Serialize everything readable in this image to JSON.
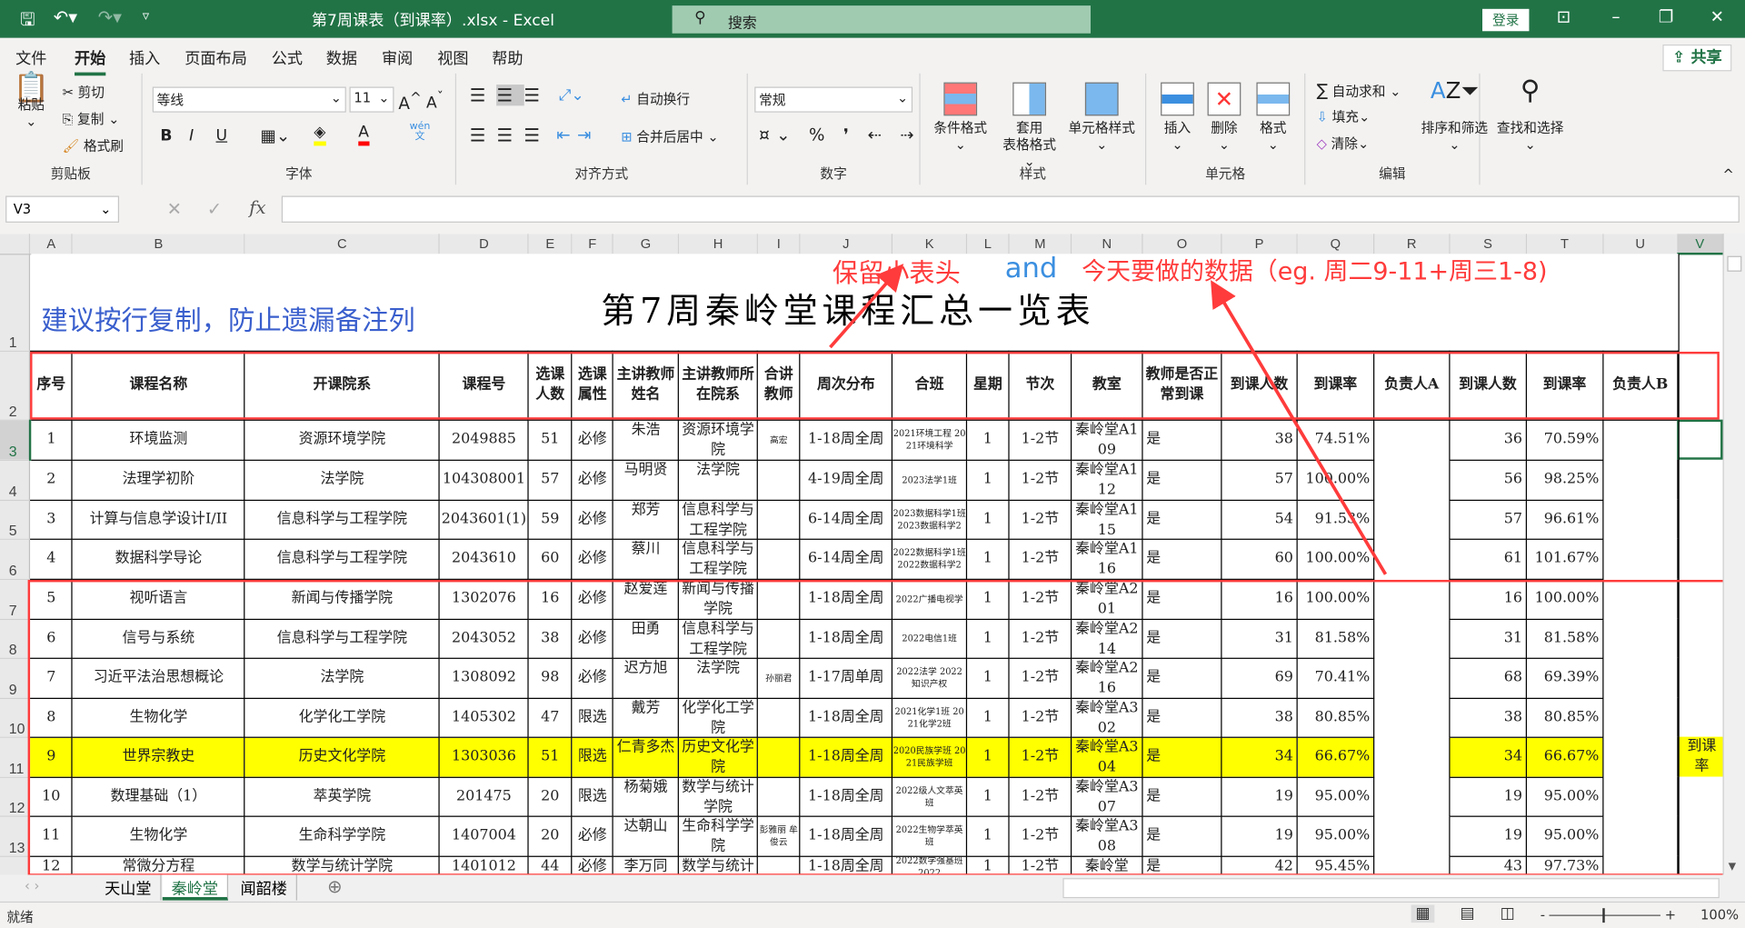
{
  "window": {
    "title": "第7周课表（到课率）.xlsx  -  Excel",
    "search_placeholder": "搜索",
    "login": "登录"
  },
  "menu": [
    "文件",
    "开始",
    "插入",
    "页面布局",
    "公式",
    "数据",
    "审阅",
    "视图",
    "帮助"
  ],
  "share": "共享",
  "ribbon": {
    "clipboard": {
      "label": "剪贴板",
      "paste": "粘贴",
      "cut": "剪切",
      "copy": "复制",
      "format_painter": "格式刷"
    },
    "font": {
      "label": "字体",
      "font_name": "等线",
      "font_size": "11",
      "bold": "B",
      "italic": "I",
      "underline": "U",
      "fill_color": "#ffff00",
      "font_color": "#ff0000"
    },
    "alignment": {
      "label": "对齐方式",
      "wrap": "自动换行",
      "merge": "合并后居中"
    },
    "number": {
      "label": "数字",
      "format": "常规"
    },
    "styles": {
      "label": "样式",
      "conditional": "条件格式",
      "table_l1": "套用",
      "table_l2": "表格格式",
      "cell_styles": "单元格样式"
    },
    "cells": {
      "label": "单元格",
      "insert": "插入",
      "delete": "删除",
      "format": "格式"
    },
    "editing": {
      "label": "编辑",
      "autosum": "自动求和",
      "fill": "填充",
      "clear": "清除",
      "sort_filter": "排序和筛选",
      "find_select": "查找和选择"
    }
  },
  "formula_bar": {
    "name_box": "V3",
    "formula": ""
  },
  "columns": [
    "A",
    "B",
    "C",
    "D",
    "E",
    "F",
    "G",
    "H",
    "I",
    "J",
    "K",
    "L",
    "M",
    "N",
    "O",
    "P",
    "Q",
    "R",
    "S",
    "T",
    "U",
    "V"
  ],
  "row_numbers": [
    "1",
    "2",
    "3",
    "4",
    "5",
    "6",
    "7",
    "8",
    "9",
    "10",
    "11",
    "12",
    "13"
  ],
  "sheet": {
    "note": "建议按行复制，防止遗漏备注列",
    "title": "第7周秦岭堂课程汇总一览表",
    "headers": [
      "序号",
      "课程名称",
      "开课院系",
      "课程号",
      "选课人数",
      "选课属性",
      "主讲教师姓名",
      "主讲教师所在院系",
      "合讲教师",
      "周次分布",
      "合班",
      "星期",
      "节次",
      "教室",
      "教师是否正常到课",
      "到课人数",
      "到课率",
      "负责人A",
      "到课人数",
      "到课率",
      "负责人B",
      ""
    ],
    "rows": [
      [
        "1",
        "环境监测",
        "资源环境学院",
        "2049885",
        "51",
        "必修",
        "朱浩",
        "资源环境学院",
        "高宏",
        "1-18周全周",
        "2021环境工程 2021环境科学",
        "1",
        "1-2节",
        "秦岭堂A109",
        "是",
        "38",
        "74.51%",
        "",
        "36",
        "70.59%",
        "",
        ""
      ],
      [
        "2",
        "法理学初阶",
        "法学院",
        "104308001",
        "57",
        "必修",
        "马明贤",
        "法学院",
        "",
        "4-19周全周",
        "2023法学1班",
        "1",
        "1-2节",
        "秦岭堂A112",
        "是",
        "57",
        "100.00%",
        "",
        "56",
        "98.25%",
        "",
        ""
      ],
      [
        "3",
        "计算与信息学设计I/II",
        "信息科学与工程学院",
        "2043601(1)",
        "59",
        "必修",
        "郑芳",
        "信息科学与工程学院",
        "",
        "6-14周全周",
        "2023数据科学1班 2023数据科学2",
        "1",
        "1-2节",
        "秦岭堂A115",
        "是",
        "54",
        "91.53%",
        "",
        "57",
        "96.61%",
        "",
        ""
      ],
      [
        "4",
        "数据科学导论",
        "信息科学与工程学院",
        "2043610",
        "60",
        "必修",
        "蔡川",
        "信息科学与工程学院",
        "",
        "6-14周全周",
        "2022数据科学1班 2022数据科学2",
        "1",
        "1-2节",
        "秦岭堂A116",
        "是",
        "60",
        "100.00%",
        "",
        "61",
        "101.67%",
        "",
        ""
      ],
      [
        "5",
        "视听语言",
        "新闻与传播学院",
        "1302076",
        "16",
        "必修",
        "赵爱莲",
        "新闻与传播学院",
        "",
        "1-18周全周",
        "2022广播电视学",
        "1",
        "1-2节",
        "秦岭堂A201",
        "是",
        "16",
        "100.00%",
        "",
        "16",
        "100.00%",
        "",
        ""
      ],
      [
        "6",
        "信号与系统",
        "信息科学与工程学院",
        "2043052",
        "38",
        "必修",
        "田勇",
        "信息科学与工程学院",
        "",
        "1-18周全周",
        "2022电信1班",
        "1",
        "1-2节",
        "秦岭堂A214",
        "是",
        "31",
        "81.58%",
        "",
        "31",
        "81.58%",
        "",
        ""
      ],
      [
        "7",
        "习近平法治思想概论",
        "法学院",
        "1308092",
        "98",
        "必修",
        "迟方旭",
        "法学院",
        "孙丽君",
        "1-17周单周",
        "2022法学 2022知识产权",
        "1",
        "1-2节",
        "秦岭堂A216",
        "是",
        "69",
        "70.41%",
        "",
        "68",
        "69.39%",
        "",
        ""
      ],
      [
        "8",
        "生物化学",
        "化学化工学院",
        "1405302",
        "47",
        "限选",
        "戴芳",
        "化学化工学院",
        "",
        "1-18周全周",
        "2021化学1班 2021化学2班",
        "1",
        "1-2节",
        "秦岭堂A302",
        "是",
        "38",
        "80.85%",
        "",
        "38",
        "80.85%",
        "",
        ""
      ],
      [
        "9",
        "世界宗教史",
        "历史文化学院",
        "1303036",
        "51",
        "限选",
        "仁青多杰",
        "历史文化学院",
        "",
        "1-18周全周",
        "2020民族学班 2021民族学班",
        "1",
        "1-2节",
        "秦岭堂A304",
        "是",
        "34",
        "66.67%",
        "",
        "34",
        "66.67%",
        "",
        "到课率"
      ],
      [
        "10",
        "数理基础（1）",
        "萃英学院",
        "201475",
        "20",
        "限选",
        "杨菊娥",
        "数学与统计学院",
        "",
        "1-18周全周",
        "2022级人文萃英班",
        "1",
        "1-2节",
        "秦岭堂A307",
        "是",
        "19",
        "95.00%",
        "",
        "19",
        "95.00%",
        "",
        ""
      ],
      [
        "11",
        "生物化学",
        "生命科学学院",
        "1407004",
        "20",
        "必修",
        "达朝山",
        "生命科学学院",
        "彭雅丽 牟俊云",
        "1-18周全周",
        "2022生物学萃英班",
        "1",
        "1-2节",
        "秦岭堂A308",
        "是",
        "19",
        "95.00%",
        "",
        "19",
        "95.00%",
        "",
        ""
      ],
      [
        "12",
        "常微分方程",
        "数学与统计学院",
        "1401012",
        "44",
        "必修",
        "李万同",
        "数学与统计学院",
        "",
        "1-18周全周",
        "2022数学强基班 2022",
        "1",
        "1-2节",
        "秦岭堂",
        "是",
        "42",
        "95.45%",
        "",
        "43",
        "97.73%",
        "",
        ""
      ]
    ],
    "highlight_row": "9",
    "highlight_color": "#ffff00"
  },
  "annotations": {
    "keep_header": "保留小表头",
    "and": "and",
    "today_data": "今天要做的数据（eg. 周二9-11+周三1-8)",
    "color_red": "#ff3b3b",
    "color_blue": "#3b8fe0"
  },
  "sheet_tabs": [
    "天山堂",
    "秦岭堂",
    "闻韶楼"
  ],
  "active_tab": "秦岭堂",
  "status": {
    "ready": "就绪",
    "zoom": "100%"
  }
}
